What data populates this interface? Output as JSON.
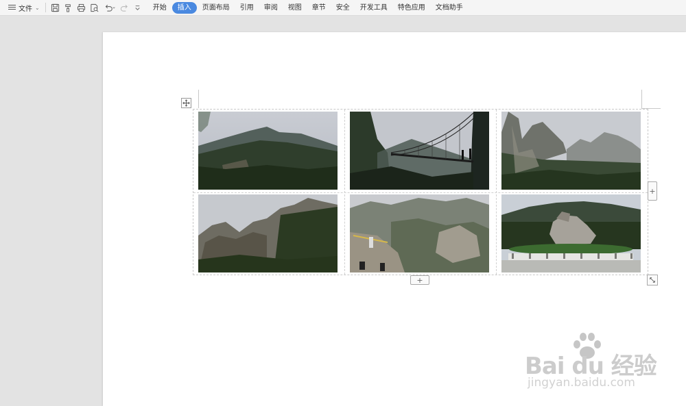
{
  "toolbar": {
    "file_label": "文件",
    "tabs": [
      {
        "label": "开始",
        "active": false
      },
      {
        "label": "插入",
        "active": true
      },
      {
        "label": "页面布局",
        "active": false
      },
      {
        "label": "引用",
        "active": false
      },
      {
        "label": "审阅",
        "active": false
      },
      {
        "label": "视图",
        "active": false
      },
      {
        "label": "章节",
        "active": false
      },
      {
        "label": "安全",
        "active": false
      },
      {
        "label": "开发工具",
        "active": false
      },
      {
        "label": "特色应用",
        "active": false
      },
      {
        "label": "文档助手",
        "active": false
      }
    ],
    "accent_color": "#4a89e0"
  },
  "document": {
    "table": {
      "rows": 2,
      "columns": 3,
      "add_column_label": "+",
      "add_row_label": "+",
      "images": [
        "mountain-forest-photo",
        "suspension-bridge-photo",
        "misty-rock-peaks-photo",
        "rocky-ridge-photo",
        "cliff-viewpoint-photo",
        "stone-turtle-statue-photo"
      ]
    }
  },
  "watermark": {
    "brand": "Bai du 经验",
    "url": "jingyan.baidu.com"
  }
}
